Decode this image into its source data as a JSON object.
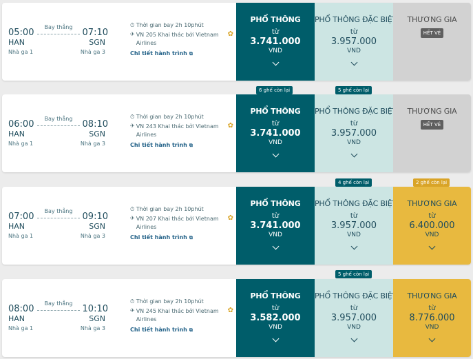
{
  "columns": {
    "economy": "PHỔ THÔNG",
    "special": "PHỔ THÔNG ĐẶC BIỆT",
    "business": "THƯƠNG GIA"
  },
  "labels": {
    "from": "từ",
    "currency": "VND",
    "sold_out": "HẾT VÉ",
    "nonstop": "Bay thẳng",
    "details": "Chi tiết hành trình",
    "duration": "Thời gian bay 2h 10phút"
  },
  "colors": {
    "economy": "#005d6a",
    "special": "#cce5e3",
    "business_available": "#e8b93f",
    "business_soldout": "#d2d2d2"
  },
  "flights": [
    {
      "dep_time": "05:00",
      "arr_time": "07:10",
      "dep_code": "HAN",
      "arr_code": "SGN",
      "dep_terminal": "Nhà ga 1",
      "arr_terminal": "Nhà ga 3",
      "flight_info": "VN 205 Khai thác bởi Vietnam Airlines",
      "economy_price": "3.741.000",
      "special_price": "3.957.000",
      "business_price": "",
      "business_status": "sold_out"
    },
    {
      "dep_time": "06:00",
      "arr_time": "08:10",
      "dep_code": "HAN",
      "arr_code": "SGN",
      "dep_terminal": "Nhà ga 1",
      "arr_terminal": "Nhà ga 3",
      "flight_info": "VN 243 Khai thác bởi Vietnam Airlines",
      "economy_price": "3.741.000",
      "special_price": "3.957.000",
      "business_price": "",
      "business_status": "sold_out",
      "badges": {
        "economy": "6 ghế còn lại",
        "special": "5 ghế còn lại"
      }
    },
    {
      "dep_time": "07:00",
      "arr_time": "09:10",
      "dep_code": "HAN",
      "arr_code": "SGN",
      "dep_terminal": "Nhà ga 1",
      "arr_terminal": "Nhà ga 3",
      "flight_info": "VN 207 Khai thác bởi Vietnam Airlines",
      "economy_price": "3.741.000",
      "special_price": "3.957.000",
      "business_price": "6.400.000",
      "business_status": "available",
      "badges": {
        "special": "4 ghế còn lại",
        "business": "2 ghế còn lại"
      }
    },
    {
      "dep_time": "08:00",
      "arr_time": "10:10",
      "dep_code": "HAN",
      "arr_code": "SGN",
      "dep_terminal": "Nhà ga 1",
      "arr_terminal": "Nhà ga 3",
      "flight_info": "VN 245 Khai thác bởi Vietnam Airlines",
      "economy_price": "3.582.000",
      "special_price": "3.957.000",
      "business_price": "8.776.000",
      "business_status": "available",
      "badges": {
        "special": "5 ghế còn lại"
      }
    }
  ]
}
